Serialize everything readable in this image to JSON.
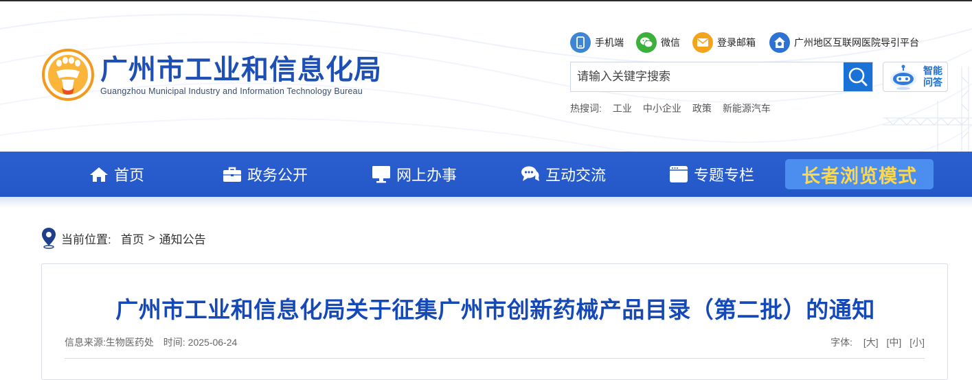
{
  "site": {
    "name_cn": "广州市工业和信息化局",
    "name_en": "Guangzhou Municipal Industry and Information Technology Bureau"
  },
  "quick_links": [
    {
      "label": "手机端",
      "icon": "mobile-icon",
      "color": "#3d86d6"
    },
    {
      "label": "微信",
      "icon": "wechat-icon",
      "color": "#3bb13b"
    },
    {
      "label": "登录邮箱",
      "icon": "mail-icon",
      "color": "#f4a41c"
    },
    {
      "label": "广州地区互联网医院导引平台",
      "icon": "hospital-icon",
      "color": "#2d72d2"
    }
  ],
  "search": {
    "placeholder": "请输入关键字搜索"
  },
  "ai_qa": {
    "label_line1": "智能",
    "label_line2": "问答"
  },
  "hot_search": {
    "label": "热搜词:",
    "terms": [
      "工业",
      "中小企业",
      "政策",
      "新能源汽车"
    ]
  },
  "nav": {
    "items": [
      {
        "label": "首页",
        "icon": "home-icon"
      },
      {
        "label": "政务公开",
        "icon": "briefcase-icon"
      },
      {
        "label": "网上办事",
        "icon": "monitor-icon"
      },
      {
        "label": "互动交流",
        "icon": "chat-icon"
      },
      {
        "label": "专题专栏",
        "icon": "window-icon"
      }
    ],
    "elder_mode": "长者浏览模式"
  },
  "breadcrumb": {
    "label": "当前位置:",
    "home": "首页",
    "separator": ">",
    "current": "通知公告"
  },
  "article": {
    "title": "广州市工业和信息化局关于征集广州市创新药械产品目录（第二批）的通知",
    "source_label": "信息来源:",
    "source": "生物医药处",
    "time_label": "时间:",
    "time": "2025-06-24",
    "font_label": "字体:",
    "font_large": "[大]",
    "font_medium": "[中]",
    "font_small": "[小]"
  },
  "colors": {
    "brand_blue": "#1e4fb5",
    "nav_blue": "#2457c8",
    "elder_bg": "#4b8ef0",
    "elder_text": "#ffd84a",
    "title_blue": "#1549b8"
  }
}
